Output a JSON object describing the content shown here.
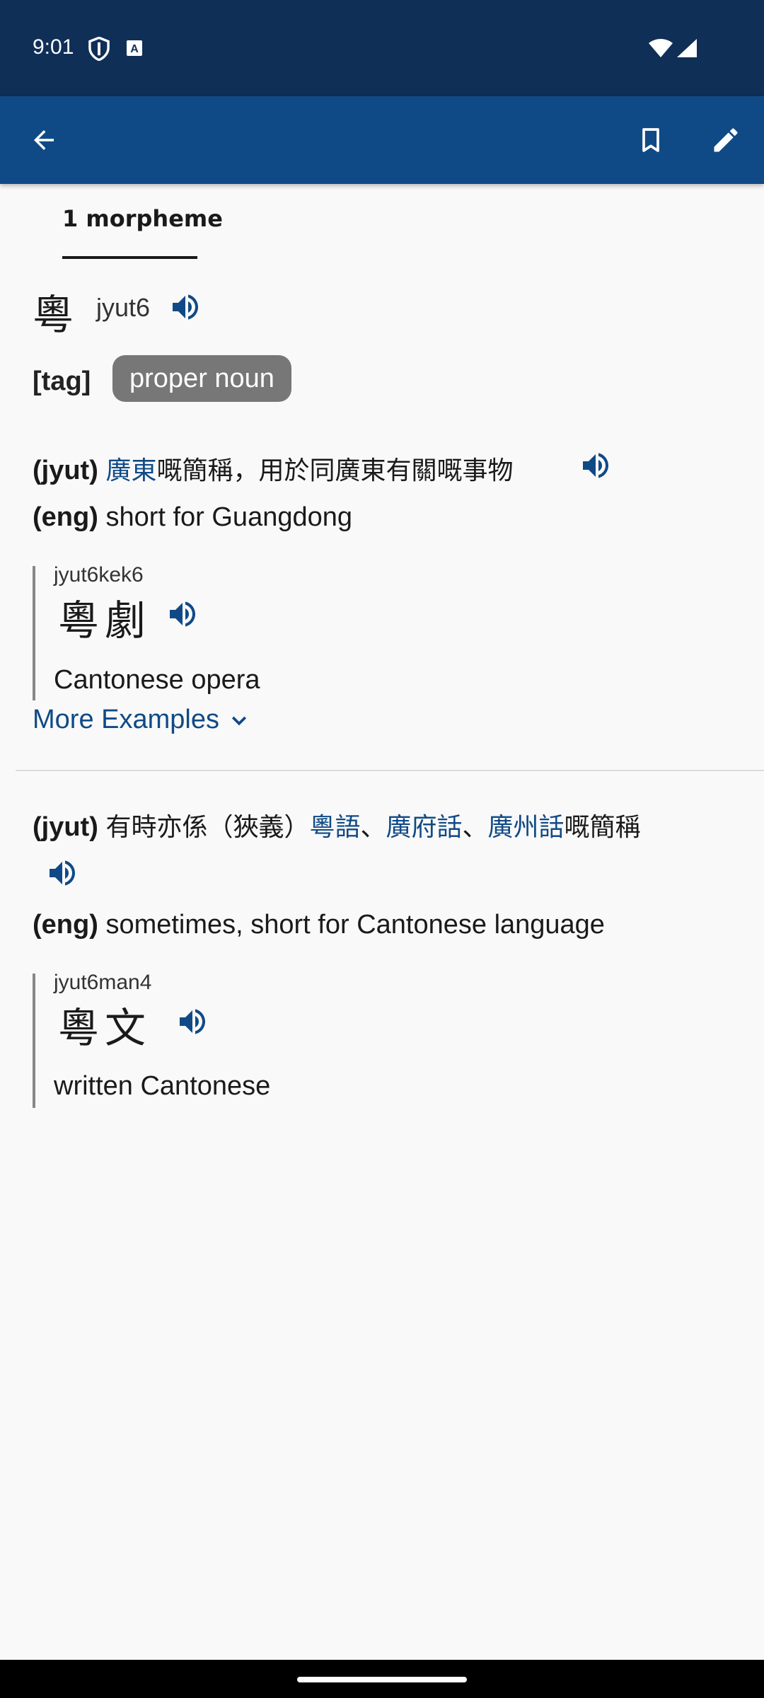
{
  "status": {
    "time": "9:01",
    "icons": [
      "shield-icon",
      "a-box-icon",
      "wifi-icon",
      "signal-icon"
    ]
  },
  "appbar": {
    "icons": [
      "back-arrow-icon",
      "bookmark-icon",
      "edit-pencil-icon"
    ],
    "background": "#104a86"
  },
  "tabs": [
    {
      "label": "1 morpheme",
      "selected": true
    }
  ],
  "headword": {
    "char": "粵",
    "jyutping": "jyut6"
  },
  "tag": {
    "label": "[tag]",
    "value": "proper noun"
  },
  "definitions": [
    {
      "jyut_prefix": "(jyut)",
      "jyut_link": "廣東",
      "jyut_text": "嘅簡稱，用於同廣東有關嘅事物",
      "eng_prefix": "(eng)",
      "eng_text": "short for Guangdong",
      "example": {
        "jyutping": "jyut6kek6",
        "chars": "粵劇",
        "eng": "Cantonese opera"
      },
      "more": "More Examples"
    },
    {
      "jyut_prefix": "(jyut)",
      "jyut_text_a": "有時亦係（狹義）",
      "link_a": "粵語",
      "sep_a": "、",
      "link_b": "廣府話",
      "sep_b": "、",
      "link_c": "廣州話",
      "jyut_text_b": "嘅簡稱",
      "eng_prefix": "(eng)",
      "eng_text": "sometimes, short for Cantonese language",
      "example": {
        "jyutping": "jyut6man4",
        "chars": "粵文",
        "eng": "written Cantonese"
      }
    }
  ],
  "colors": {
    "accent": "#104a86",
    "statusbar": "#0f2f57",
    "chip": "#777777"
  }
}
